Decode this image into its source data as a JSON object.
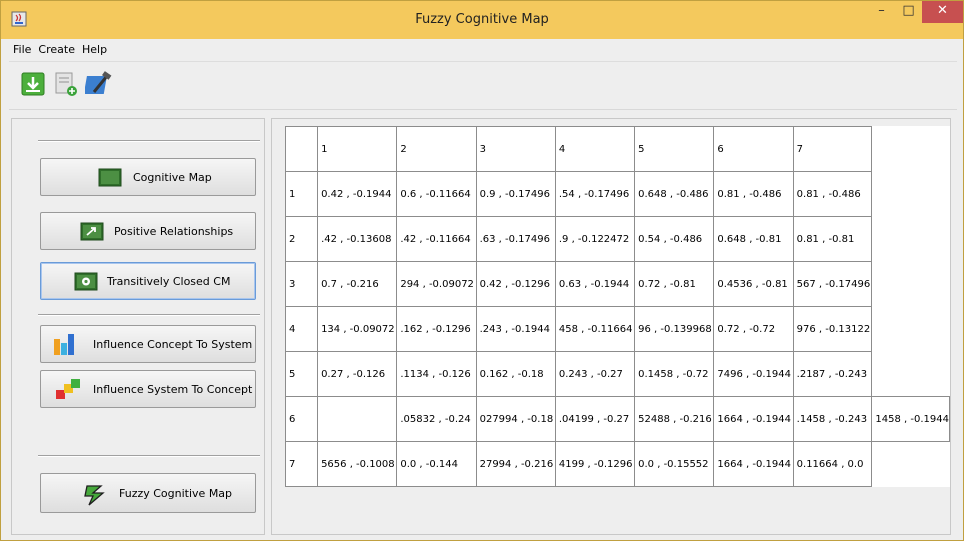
{
  "window": {
    "title": "Fuzzy Cognitive Map",
    "minimize": "–",
    "maximize": "□",
    "close": "✕"
  },
  "menu": [
    "File",
    "Create",
    "Help"
  ],
  "toolbar": {
    "items": [
      "download-icon",
      "page-add-icon",
      "tools-icon"
    ]
  },
  "nav": {
    "cognitive_map": "Cognitive Map",
    "positive_relationships": "Positive Relationships",
    "transitively_closed": "Transitively Closed CM",
    "influence_concept_to_system": "Influence Concept To System",
    "influence_system_to_concept": "Influence System To Concept",
    "fuzzy_cognitive_map": "Fuzzy Cognitive Map"
  },
  "table": {
    "columns": [
      "",
      "1",
      "2",
      "3",
      "4",
      "5",
      "6",
      "7"
    ],
    "rows": [
      [
        "1",
        "0.42 , -0.1944",
        "0.6 , -0.11664",
        "0.9 , -0.17496",
        ".54 , -0.17496",
        "0.648 , -0.486",
        "0.81 , -0.486",
        "0.81 , -0.486"
      ],
      [
        "2",
        ".42 , -0.13608",
        ".42 , -0.11664",
        ".63 , -0.17496",
        ".9 , -0.122472",
        "0.54 , -0.486",
        "0.648 , -0.81",
        "0.81 , -0.81"
      ],
      [
        "3",
        "0.7 , -0.216",
        "294 , -0.09072",
        "0.42 , -0.1296",
        "0.63 , -0.1944",
        "0.72 , -0.81",
        "0.4536 , -0.81",
        "567 , -0.17496"
      ],
      [
        "4",
        "134 , -0.09072",
        ".162 , -0.1296",
        ".243 , -0.1944",
        "458 , -0.11664",
        "96 , -0.139968",
        "0.72 , -0.72",
        "976 , -0.13122"
      ],
      [
        "5",
        "0.27 , -0.126",
        ".1134 , -0.126",
        "0.162 , -0.18",
        "0.243 , -0.27",
        "0.1458 , -0.72",
        "7496 , -0.1944",
        ".2187 , -0.243"
      ],
      [
        "6",
        "",
        ".05832 , -0.24",
        "027994 , -0.18",
        ".04199 , -0.27",
        "52488 , -0.216",
        "1664 , -0.1944",
        ".1458 , -0.243",
        "1458 , -0.1944"
      ],
      [
        "7",
        "5656 , -0.1008",
        "0.0 , -0.144",
        "27994 , -0.216",
        "4199 , -0.1296",
        "0.0 , -0.15552",
        "1664 , -0.1944",
        "0.11664 , 0.0"
      ]
    ]
  }
}
